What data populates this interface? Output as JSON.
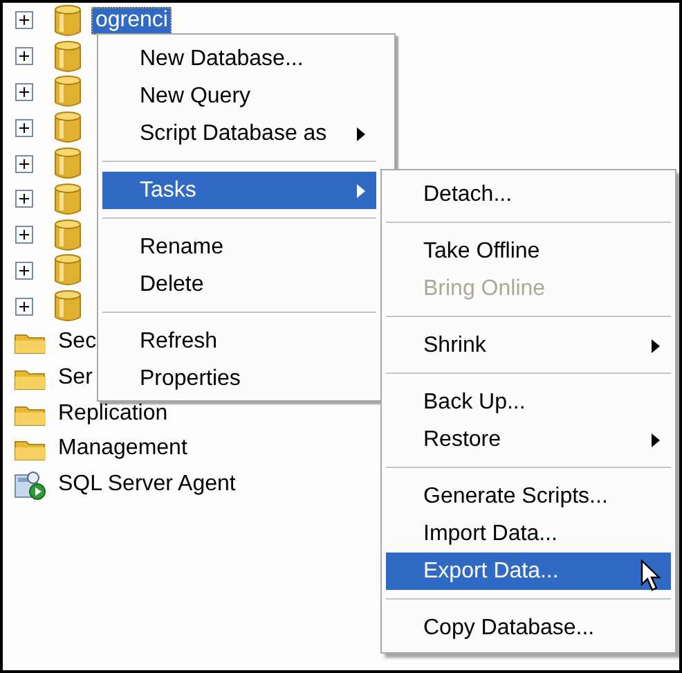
{
  "tree": {
    "items": [
      {
        "kind": "database",
        "label": "ogrenci",
        "selected": true,
        "expanded": false
      },
      {
        "kind": "database",
        "selected": false,
        "expanded": false
      },
      {
        "kind": "database",
        "selected": false,
        "expanded": false
      },
      {
        "kind": "database",
        "selected": false,
        "expanded": false
      },
      {
        "kind": "database",
        "selected": false,
        "expanded": false
      },
      {
        "kind": "database",
        "selected": false,
        "expanded": false
      },
      {
        "kind": "database",
        "selected": false,
        "expanded": false
      },
      {
        "kind": "database",
        "selected": false,
        "expanded": false
      },
      {
        "kind": "database",
        "selected": false,
        "expanded": false
      },
      {
        "kind": "folder",
        "label": "Sec",
        "selected": false
      },
      {
        "kind": "folder",
        "label": "Ser",
        "selected": false
      },
      {
        "kind": "folder",
        "label": "Replication",
        "selected": false
      },
      {
        "kind": "folder",
        "label": "Management",
        "selected": false
      },
      {
        "kind": "agent",
        "label": "SQL Server Agent",
        "selected": false
      }
    ]
  },
  "context_menu": {
    "items": [
      {
        "kind": "item",
        "label": "New Database...",
        "selected": false,
        "disabled": false,
        "submenu": false
      },
      {
        "kind": "item",
        "label": "New Query",
        "selected": false,
        "disabled": false,
        "submenu": false
      },
      {
        "kind": "item",
        "label": "Script Database as",
        "selected": false,
        "disabled": false,
        "submenu": true
      },
      {
        "kind": "separator"
      },
      {
        "kind": "item",
        "label": "Tasks",
        "selected": true,
        "disabled": false,
        "submenu": true
      },
      {
        "kind": "separator"
      },
      {
        "kind": "item",
        "label": "Rename",
        "selected": false,
        "disabled": false,
        "submenu": false
      },
      {
        "kind": "item",
        "label": "Delete",
        "selected": false,
        "disabled": false,
        "submenu": false
      },
      {
        "kind": "separator"
      },
      {
        "kind": "item",
        "label": "Refresh",
        "selected": false,
        "disabled": false,
        "submenu": false
      },
      {
        "kind": "item",
        "label": "Properties",
        "selected": false,
        "disabled": false,
        "submenu": false
      }
    ]
  },
  "tasks_submenu": {
    "items": [
      {
        "kind": "item",
        "label": "Detach...",
        "selected": false,
        "disabled": false,
        "submenu": false
      },
      {
        "kind": "separator"
      },
      {
        "kind": "item",
        "label": "Take Offline",
        "selected": false,
        "disabled": false,
        "submenu": false
      },
      {
        "kind": "item",
        "label": "Bring Online",
        "selected": false,
        "disabled": true,
        "submenu": false
      },
      {
        "kind": "separator"
      },
      {
        "kind": "item",
        "label": "Shrink",
        "selected": false,
        "disabled": false,
        "submenu": true
      },
      {
        "kind": "separator"
      },
      {
        "kind": "item",
        "label": "Back Up...",
        "selected": false,
        "disabled": false,
        "submenu": false
      },
      {
        "kind": "item",
        "label": "Restore",
        "selected": false,
        "disabled": false,
        "submenu": true
      },
      {
        "kind": "separator"
      },
      {
        "kind": "item",
        "label": "Generate Scripts...",
        "selected": false,
        "disabled": false,
        "submenu": false
      },
      {
        "kind": "item",
        "label": "Import Data...",
        "selected": false,
        "disabled": false,
        "submenu": false
      },
      {
        "kind": "item",
        "label": "Export Data...",
        "selected": true,
        "disabled": false,
        "submenu": false
      },
      {
        "kind": "separator"
      },
      {
        "kind": "item",
        "label": "Copy Database...",
        "selected": false,
        "disabled": false,
        "submenu": false
      }
    ]
  }
}
